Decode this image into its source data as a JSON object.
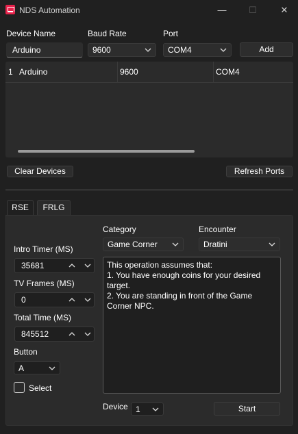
{
  "window": {
    "title": "NDS Automation",
    "minimize_glyph": "—",
    "maximize_glyph": "☐",
    "close_glyph": "✕",
    "icon": "app-icon"
  },
  "device_form": {
    "device_name_label": "Device Name",
    "device_name_value": "Arduino",
    "baud_rate_label": "Baud Rate",
    "baud_rate_value": "9600",
    "port_label": "Port",
    "port_value": "COM4",
    "add_label": "Add"
  },
  "devices_table": {
    "rows": [
      {
        "index": "1",
        "name": "Arduino",
        "baud": "9600",
        "port": "COM4"
      }
    ]
  },
  "actions": {
    "clear_label": "Clear Devices",
    "refresh_label": "Refresh Ports"
  },
  "tabs": [
    {
      "label": "RSE",
      "selected": false
    },
    {
      "label": "FRLG",
      "selected": true
    }
  ],
  "frlg": {
    "intro_timer_label": "Intro Timer (MS)",
    "intro_timer_value": "35681",
    "tv_frames_label": "TV Frames (MS)",
    "tv_frames_value": "0",
    "total_time_label": "Total Time (MS)",
    "total_time_value": "845512",
    "button_label": "Button",
    "button_value": "A",
    "select_label": "Select",
    "select_checked": false,
    "category_label": "Category",
    "category_value": "Game Corner",
    "encounter_label": "Encounter",
    "encounter_value": "Dratini",
    "description": "This operation assumes that:\n1. You have enough coins for your desired target.\n2. You are standing in front of the Game Corner NPC.",
    "device_label": "Device",
    "device_value": "1",
    "start_label": "Start"
  },
  "colors": {
    "background": "#202020",
    "panel": "#2b2b2b",
    "control": "#2d2d2d",
    "accent_icon": "#e8224b"
  }
}
